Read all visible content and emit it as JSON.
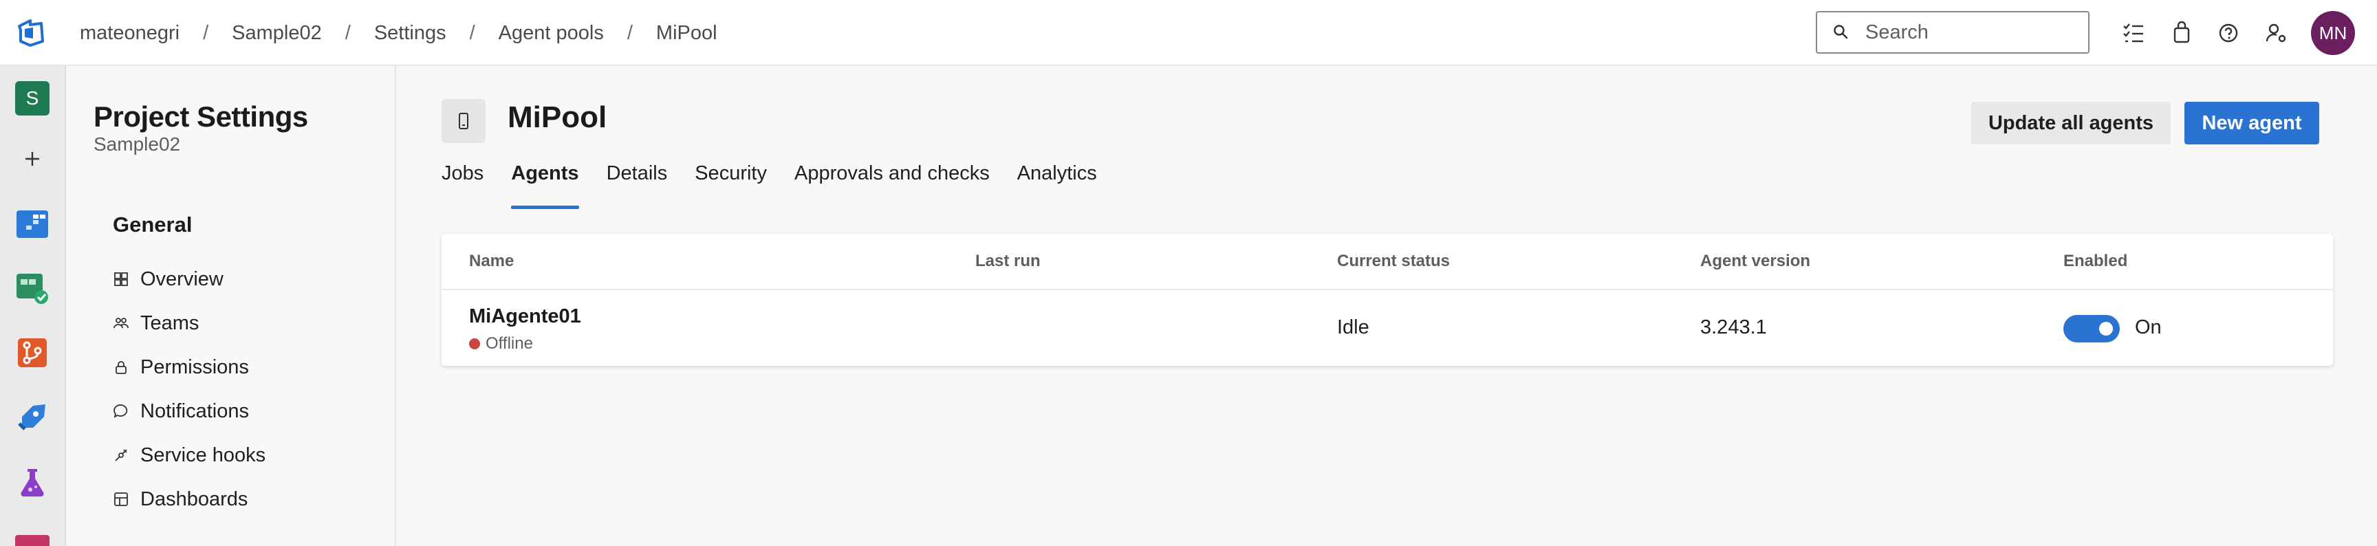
{
  "breadcrumb": [
    "mateonegri",
    "Sample02",
    "Settings",
    "Agent pools",
    "MiPool"
  ],
  "breadcrumb_separator": "/",
  "search": {
    "placeholder": "Search"
  },
  "user": {
    "initials": "MN",
    "avatar_color": "#6b1f5f"
  },
  "rail": {
    "project_initial": "S",
    "items": [
      "project-badge",
      "new-icon",
      "boards-icon",
      "test-plans-icon",
      "repos-icon",
      "pipelines-icon",
      "artifacts-icon"
    ]
  },
  "settings_nav": {
    "title": "Project Settings",
    "subtitle": "Sample02",
    "section": "General",
    "items": [
      {
        "label": "Overview",
        "icon": "overview-icon"
      },
      {
        "label": "Teams",
        "icon": "teams-icon"
      },
      {
        "label": "Permissions",
        "icon": "lock-icon"
      },
      {
        "label": "Notifications",
        "icon": "chat-icon"
      },
      {
        "label": "Service hooks",
        "icon": "hook-icon"
      },
      {
        "label": "Dashboards",
        "icon": "dashboard-icon"
      }
    ]
  },
  "pool": {
    "title": "MiPool",
    "update_all_label": "Update all agents",
    "new_agent_label": "New agent"
  },
  "tabs": [
    "Jobs",
    "Agents",
    "Details",
    "Security",
    "Approvals and checks",
    "Analytics"
  ],
  "active_tab": "Agents",
  "table": {
    "columns": [
      "Name",
      "Last run",
      "Current status",
      "Agent version",
      "Enabled"
    ],
    "rows": [
      {
        "name": "MiAgente01",
        "status": "Offline",
        "last_run": "",
        "current_status": "Idle",
        "agent_version": "3.243.1",
        "enabled": true,
        "enabled_label": "On"
      }
    ]
  },
  "colors": {
    "accent": "#2b73d2",
    "offline": "#c9463d",
    "project_badge": "#1e7a53"
  }
}
